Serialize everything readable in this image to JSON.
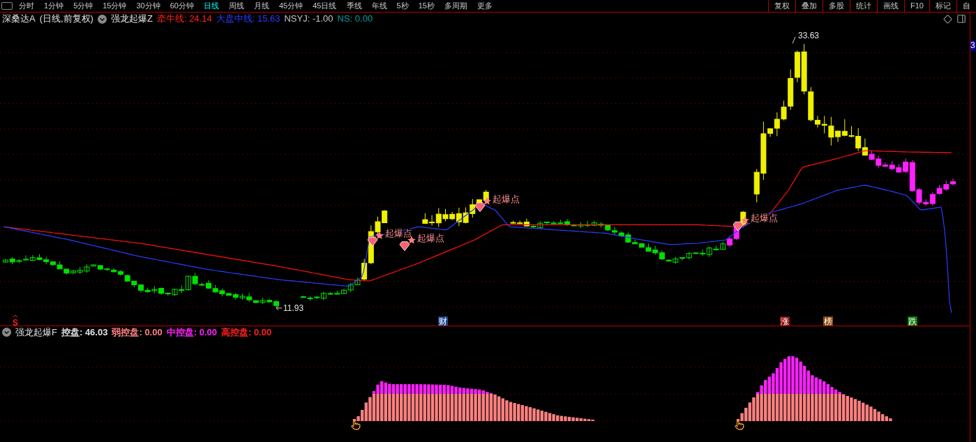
{
  "toolbar": {
    "periods": [
      {
        "label": "分时",
        "selected": false
      },
      {
        "label": "1分钟",
        "selected": false
      },
      {
        "label": "5分钟",
        "selected": false
      },
      {
        "label": "15分钟",
        "selected": false
      },
      {
        "label": "30分钟",
        "selected": false
      },
      {
        "label": "60分钟",
        "selected": false
      },
      {
        "label": "日线",
        "selected": true
      },
      {
        "label": "周线",
        "selected": false
      },
      {
        "label": "月线",
        "selected": false
      },
      {
        "label": "45分钟",
        "selected": false
      },
      {
        "label": "45日线",
        "selected": false
      },
      {
        "label": "季线",
        "selected": false
      },
      {
        "label": "年线",
        "selected": false
      },
      {
        "label": "5秒",
        "selected": false
      },
      {
        "label": "15秒",
        "selected": false
      },
      {
        "label": "多周期",
        "selected": false
      },
      {
        "label": "更多",
        "selected": false
      }
    ],
    "actions": [
      "复权",
      "叠加",
      "多股",
      "统计",
      "画线",
      "F10",
      "标记",
      "自"
    ]
  },
  "main_chart": {
    "stock": "深桑达A",
    "mode": "(日线,前复权)",
    "indicator": "强龙起爆Z",
    "series": [
      {
        "text": "牵牛线: 24.14",
        "color": "#ff2020"
      },
      {
        "text": "大盘中线: 15.63",
        "color": "#2a3cff"
      },
      {
        "text": "NSYJ: -1.00",
        "color": "#c8c8c8"
      },
      {
        "text": "NS: 0.00",
        "color": "#00a0a0"
      }
    ],
    "high_label": "33.63",
    "low_label": "11.93",
    "signals": [
      "起爆点",
      "起爆点",
      "起爆点",
      "起爆点"
    ],
    "events": [
      {
        "kind": "text",
        "label": "S",
        "color": "#ff2020"
      },
      {
        "kind": "badge",
        "label": "财",
        "color": "#1e4690"
      },
      {
        "kind": "badge",
        "label": "涨",
        "color": "#8b1010"
      },
      {
        "kind": "badge",
        "label": "榜",
        "color": "#8b4a10"
      },
      {
        "kind": "badge",
        "label": "跌",
        "color": "#0a7a0a"
      }
    ],
    "axis_marker": "3"
  },
  "indicator_panel": {
    "name": "强龙起爆F",
    "series": [
      {
        "text": "控盘: 46.03",
        "color": "#e0e0e0"
      },
      {
        "text": "弱控盘: 0.00",
        "color": "#ff8080"
      },
      {
        "text": "中控盘: 0.00",
        "color": "#ff20ff"
      },
      {
        "text": "高控盘: 0.00",
        "color": "#ff2020"
      }
    ]
  }
}
